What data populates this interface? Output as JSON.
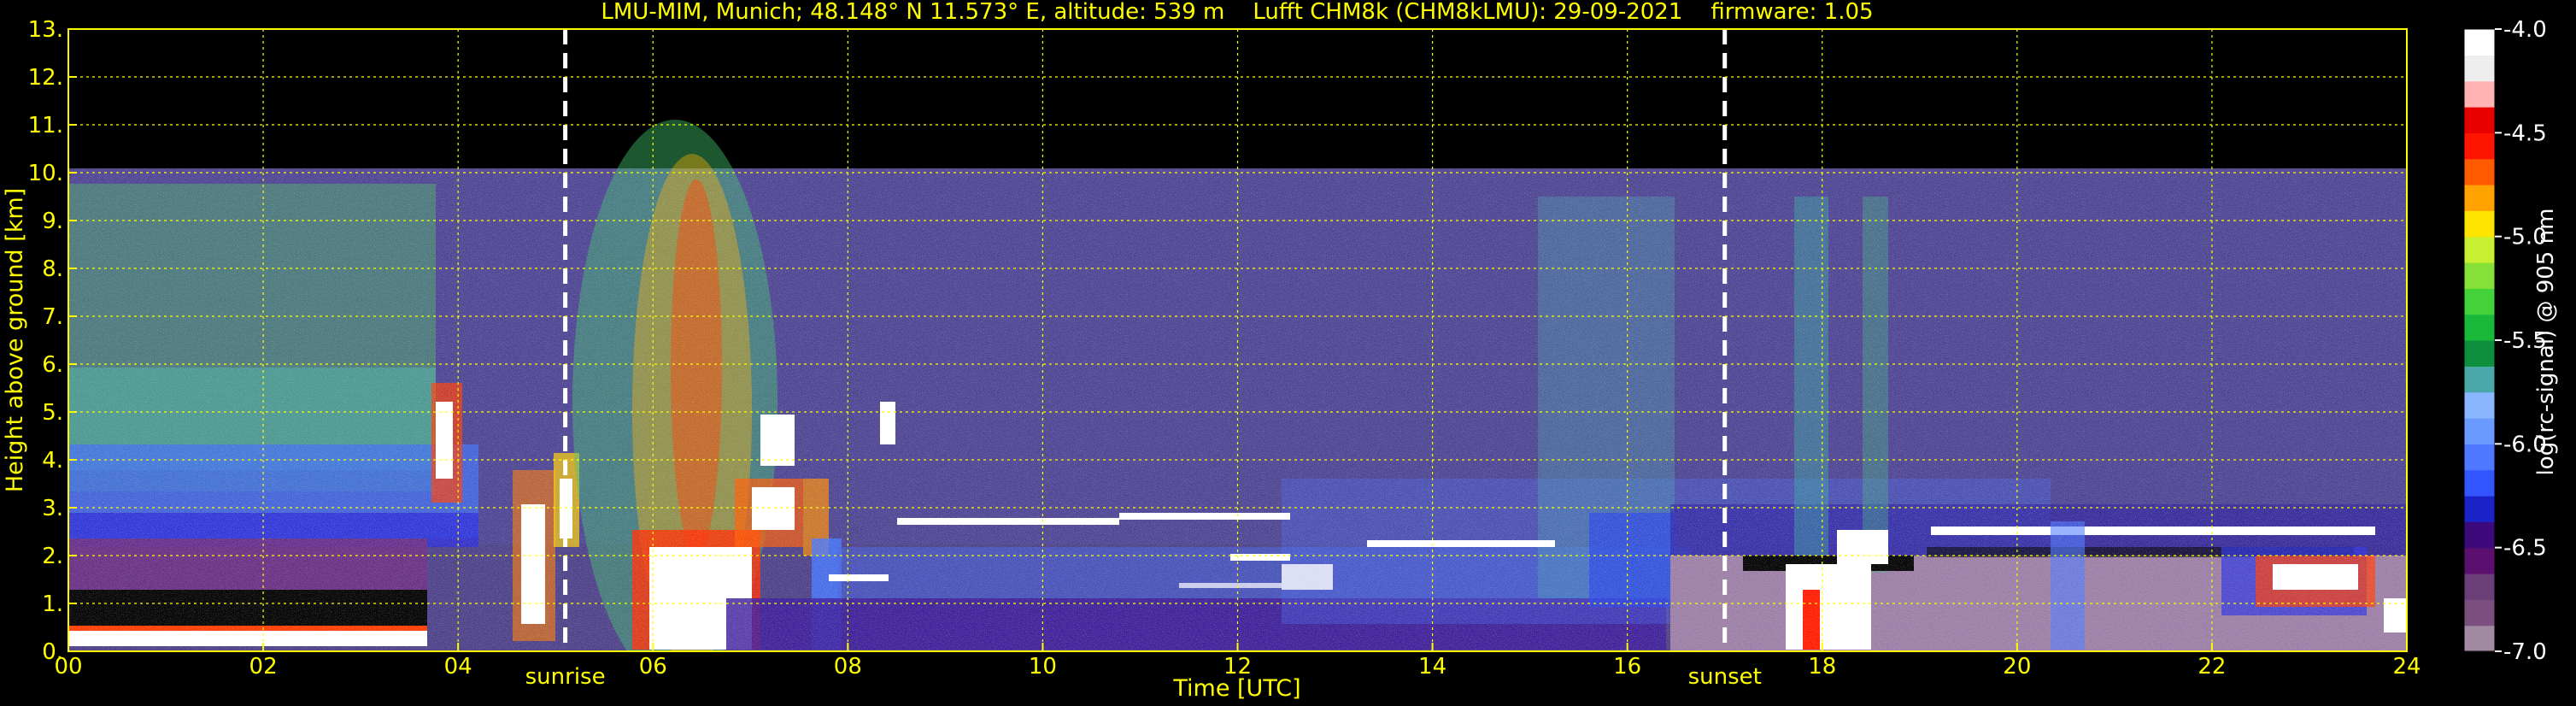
{
  "chart_data": {
    "type": "heatmap",
    "title": "LMU-MIM, Munich; 48.148° N 11.573° E, altitude: 539 m    Lufft CHM8k (CHM8kLMU): 29-09-2021    firmware: 1.05",
    "xlabel": "Time [UTC]",
    "ylabel": "Height above ground [km]",
    "xlim": [
      0,
      24
    ],
    "ylim": [
      0,
      13
    ],
    "x_ticks": [
      "00",
      "02",
      "04",
      "06",
      "08",
      "10",
      "12",
      "14",
      "16",
      "18",
      "20",
      "22",
      "24"
    ],
    "y_ticks": [
      "0.",
      "1.",
      "2.",
      "3.",
      "4.",
      "5.",
      "6.",
      "7.",
      "8.",
      "9.",
      "10.",
      "11.",
      "12.",
      "13."
    ],
    "grid": true,
    "grid_color": "#ffff00",
    "text_color": "#ffff00",
    "colorbar": {
      "label": "log(rc-signal) @ 905 nm",
      "range": [
        -7.0,
        -4.0
      ],
      "ticks": [
        "-4.0",
        "-4.5",
        "-5.0",
        "-5.5",
        "-6.0",
        "-6.5",
        "-7.0"
      ],
      "colors": [
        "#a28aa2",
        "#7a4e7e",
        "#6a3e76",
        "#5b0f6e",
        "#3c0a7a",
        "#1a22c8",
        "#3355ff",
        "#4d78ff",
        "#6b9aff",
        "#8ab6ff",
        "#4aa8aa",
        "#0c8e3c",
        "#18b838",
        "#44d23a",
        "#86e038",
        "#c8ef30",
        "#ffe400",
        "#ffa200",
        "#ff5a00",
        "#ff1400",
        "#e80000",
        "#ffb3b3",
        "#eeeeee",
        "#ffffff"
      ]
    },
    "annotations": [
      {
        "text": "sunrise",
        "x": 5.1
      },
      {
        "text": "sunset",
        "x": 17.0
      }
    ]
  }
}
